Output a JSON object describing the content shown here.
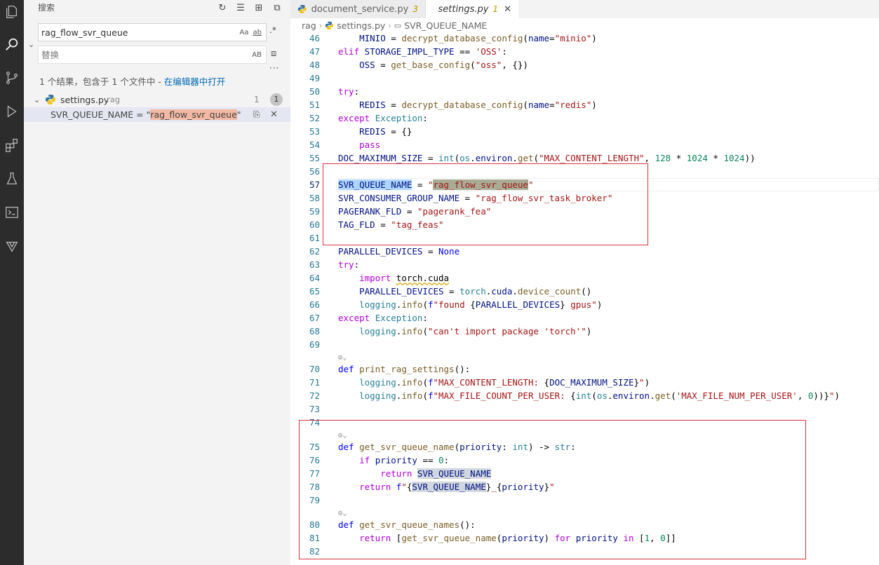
{
  "sidebar": {
    "header": "搜索",
    "search_value": "rag_flow_svr_queue",
    "search_options": {
      "match_case": "Aa",
      "whole_word": "ab",
      "regex": ".*"
    },
    "replace_placeholder": "替换",
    "replace_all": "AB",
    "more": "···",
    "summary_prefix": "1 个结果，包含于 1 个文件中 - ",
    "summary_link": "在编辑器中打开",
    "file": {
      "name": "settings.py",
      "path": "rag",
      "count": "1",
      "badge": "1"
    },
    "match": {
      "before": "SVR_QUEUE_NAME = \"",
      "hit": "rag_flow_svr_queue",
      "after": "\""
    }
  },
  "tabs": [
    {
      "name": "document_service.py",
      "badge": "3",
      "active": false
    },
    {
      "name": "settings.py",
      "badge": "1",
      "active": true
    }
  ],
  "breadcrumb": {
    "folder": "rag",
    "file": "settings.py",
    "symbol": "SVR_QUEUE_NAME"
  },
  "code_lines": [
    {
      "num": "46",
      "text": "    MINIO = decrypt_database_config(name=\"minio\")"
    },
    {
      "num": "47",
      "text": "elif STORAGE_IMPL_TYPE == 'OSS':"
    },
    {
      "num": "48",
      "text": "    OSS = get_base_config(\"oss\", {})"
    },
    {
      "num": "49",
      "text": ""
    },
    {
      "num": "50",
      "text": "try:"
    },
    {
      "num": "51",
      "text": "    REDIS = decrypt_database_config(name=\"redis\")"
    },
    {
      "num": "52",
      "text": "except Exception:"
    },
    {
      "num": "53",
      "text": "    REDIS = {}"
    },
    {
      "num": "54",
      "text": "    pass"
    },
    {
      "num": "55",
      "text": "DOC_MAXIMUM_SIZE = int(os.environ.get(\"MAX_CONTENT_LENGTH\", 128 * 1024 * 1024))"
    },
    {
      "num": "56",
      "text": ""
    },
    {
      "num": "57",
      "text": "SVR_QUEUE_NAME = \"rag_flow_svr_queue\""
    },
    {
      "num": "58",
      "text": "SVR_CONSUMER_GROUP_NAME = \"rag_flow_svr_task_broker\""
    },
    {
      "num": "59",
      "text": "PAGERANK_FLD = \"pagerank_fea\""
    },
    {
      "num": "60",
      "text": "TAG_FLD = \"tag_feas\""
    },
    {
      "num": "61",
      "text": ""
    },
    {
      "num": "62",
      "text": "PARALLEL_DEVICES = None"
    },
    {
      "num": "63",
      "text": "try:"
    },
    {
      "num": "64",
      "text": "    import torch.cuda"
    },
    {
      "num": "65",
      "text": "    PARALLEL_DEVICES = torch.cuda.device_count()"
    },
    {
      "num": "66",
      "text": "    logging.info(f\"found {PARALLEL_DEVICES} gpus\")"
    },
    {
      "num": "67",
      "text": "except Exception:"
    },
    {
      "num": "68",
      "text": "    logging.info(\"can't import package 'torch'\")"
    },
    {
      "num": "69",
      "text": ""
    },
    {
      "num": "70",
      "text": "def print_rag_settings():"
    },
    {
      "num": "71",
      "text": "    logging.info(f\"MAX_CONTENT_LENGTH: {DOC_MAXIMUM_SIZE}\")"
    },
    {
      "num": "72",
      "text": "    logging.info(f\"MAX_FILE_COUNT_PER_USER: {int(os.environ.get('MAX_FILE_NUM_PER_USER', 0))}\")"
    },
    {
      "num": "73",
      "text": ""
    },
    {
      "num": "74",
      "text": ""
    },
    {
      "num": "75",
      "text": "def get_svr_queue_name(priority: int) -> str:"
    },
    {
      "num": "76",
      "text": "    if priority == 0:"
    },
    {
      "num": "77",
      "text": "        return SVR_QUEUE_NAME"
    },
    {
      "num": "78",
      "text": "    return f\"{SVR_QUEUE_NAME}_{priority}\""
    },
    {
      "num": "79",
      "text": ""
    },
    {
      "num": "80",
      "text": "def get_svr_queue_names():"
    },
    {
      "num": "81",
      "text": "    return [get_svr_queue_name(priority) for priority in [1, 0]]"
    },
    {
      "num": "82",
      "text": ""
    }
  ],
  "colors": {
    "keyword": "#af00db",
    "string": "#a31515",
    "number": "#098658",
    "variable": "#001080",
    "accent": "#006ab1",
    "annotation_box": "#d9333f"
  }
}
